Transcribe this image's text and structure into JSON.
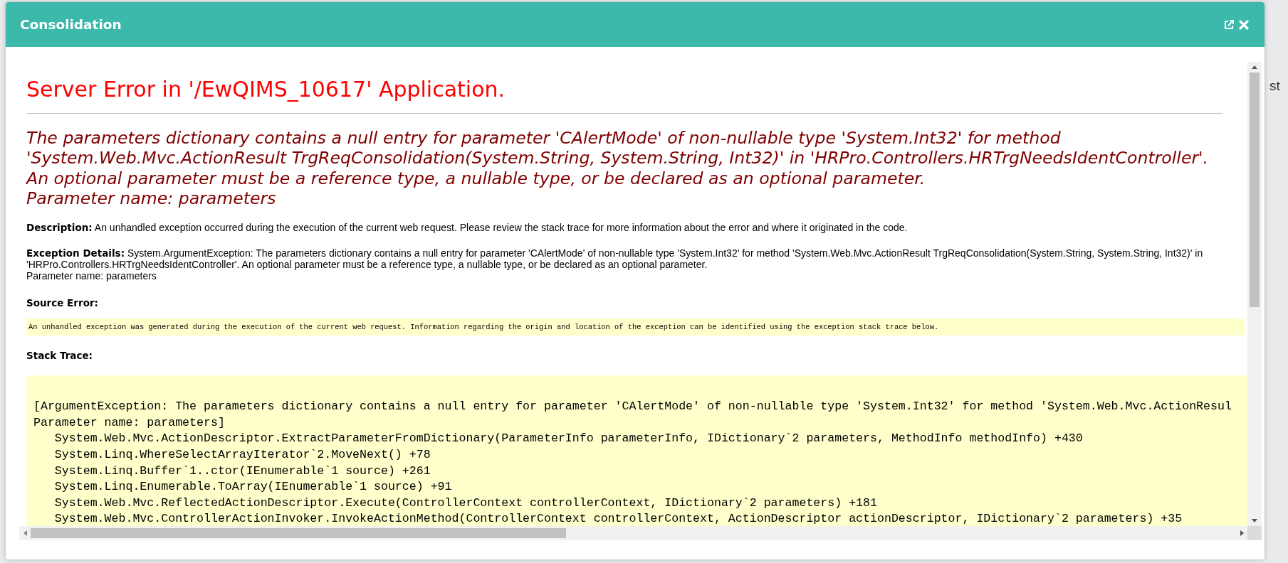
{
  "background_text": "st",
  "dialog": {
    "title": "Consolidation"
  },
  "error_page": {
    "heading": "Server Error in '/EwQIMS_10617' Application.",
    "message_lines": [
      "The parameters dictionary contains a null entry for parameter 'CAlertMode' of non-nullable type 'System.Int32' for method",
      "'System.Web.Mvc.ActionResult TrgReqConsolidation(System.String, System.String, Int32)' in 'HRPro.Controllers.HRTrgNeedsIdentController'.",
      "An optional parameter must be a reference type, a nullable type, or be declared as an optional parameter.",
      "Parameter name: parameters"
    ],
    "description": {
      "label": "Description:",
      "text": "An unhandled exception occurred during the execution of the current web request. Please review the stack trace for more information about the error and where it originated in the code."
    },
    "exception_details": {
      "label": "Exception Details:",
      "lines": [
        "System.ArgumentException: The parameters dictionary contains a null entry for parameter 'CAlertMode' of non-nullable type 'System.Int32' for method 'System.Web.Mvc.ActionResult TrgReqConsolidation(System.String, System.String, Int32)' in",
        "'HRPro.Controllers.HRTrgNeedsIdentController'. An optional parameter must be a reference type, a nullable type, or be declared as an optional parameter.",
        "Parameter name: parameters"
      ]
    },
    "source_error": {
      "label": "Source Error:",
      "code": "An unhandled exception was generated during the execution of the current web request. Information regarding the origin and location of the exception can be identified using the exception stack trace below."
    },
    "stack_trace": {
      "label": "Stack Trace:",
      "lines": [
        "[ArgumentException: The parameters dictionary contains a null entry for parameter 'CAlertMode' of non-nullable type 'System.Int32' for method 'System.Web.Mvc.ActionResul",
        "Parameter name: parameters]",
        "   System.Web.Mvc.ActionDescriptor.ExtractParameterFromDictionary(ParameterInfo parameterInfo, IDictionary`2 parameters, MethodInfo methodInfo) +430",
        "   System.Linq.WhereSelectArrayIterator`2.MoveNext() +78",
        "   System.Linq.Buffer`1..ctor(IEnumerable`1 source) +261",
        "   System.Linq.Enumerable.ToArray(IEnumerable`1 source) +91",
        "   System.Web.Mvc.ReflectedActionDescriptor.Execute(ControllerContext controllerContext, IDictionary`2 parameters) +181",
        "   System.Web.Mvc.ControllerActionInvoker.InvokeActionMethod(ControllerContext controllerContext, ActionDescriptor actionDescriptor, IDictionary`2 parameters) +35"
      ]
    }
  }
}
